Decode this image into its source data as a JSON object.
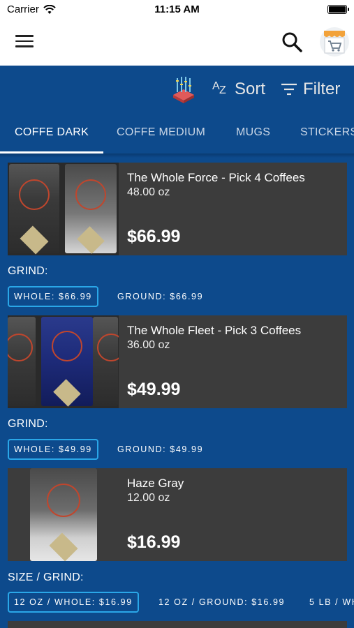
{
  "status": {
    "carrier": "Carrier",
    "time": "11:15 AM"
  },
  "toolbar": {
    "sort_label": "Sort",
    "filter_label": "Filter",
    "az_a": "A",
    "az_z": "Z"
  },
  "tabs": [
    {
      "label": "COFFE DARK"
    },
    {
      "label": "COFFE MEDIUM"
    },
    {
      "label": "MUGS"
    },
    {
      "label": "STICKERS"
    }
  ],
  "products": [
    {
      "name": "The Whole Force - Pick 4 Coffees",
      "weight": "48.00 oz",
      "price": "$66.99",
      "option_label": "GRIND:",
      "options": [
        "WHOLE: $66.99",
        "GROUND: $66.99"
      ]
    },
    {
      "name": "The Whole Fleet - Pick 3 Coffees",
      "weight": "36.00 oz",
      "price": "$49.99",
      "option_label": "GRIND:",
      "options": [
        "WHOLE: $49.99",
        "GROUND: $49.99"
      ]
    },
    {
      "name": "Haze Gray",
      "weight": "12.00 oz",
      "price": "$16.99",
      "option_label": "SIZE / GRIND:",
      "options": [
        "12 OZ / WHOLE: $16.99",
        "12 OZ / GROUND: $16.99",
        "5 LB / WH"
      ]
    }
  ],
  "colors": {
    "background": "#0d4a8c",
    "card": "#3c3c3c",
    "chip_selected_border": "#2aa7e8"
  }
}
